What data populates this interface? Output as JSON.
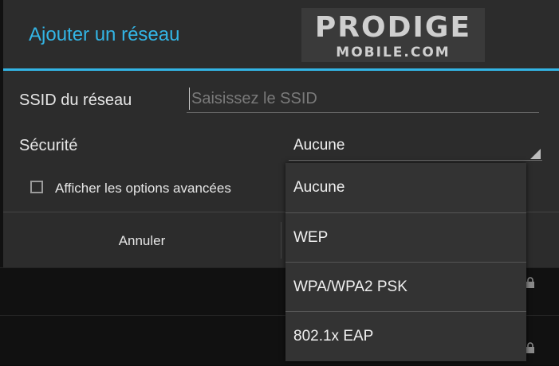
{
  "dialog": {
    "title": "Ajouter un réseau",
    "ssid": {
      "label": "SSID du réseau",
      "placeholder": "Saisissez le SSID",
      "value": ""
    },
    "security": {
      "label": "Sécurité",
      "selected": "Aucune"
    },
    "advanced_options": {
      "label": "Afficher les options avancées",
      "checked": false
    },
    "buttons": {
      "cancel": "Annuler"
    }
  },
  "dropdown": {
    "options": [
      "Aucune",
      "WEP",
      "WPA/WPA2 PSK",
      "802.1x EAP"
    ]
  },
  "watermark": {
    "line1": "PRODIGE",
    "line2": "MOBILE.COM"
  },
  "colors": {
    "accent": "#33b5e5",
    "dialog_bg": "#2c2c2c",
    "dropdown_bg": "#333333"
  },
  "icons": {
    "background_rows": "lock-icon",
    "spinner": "spinner-arrow-icon"
  }
}
